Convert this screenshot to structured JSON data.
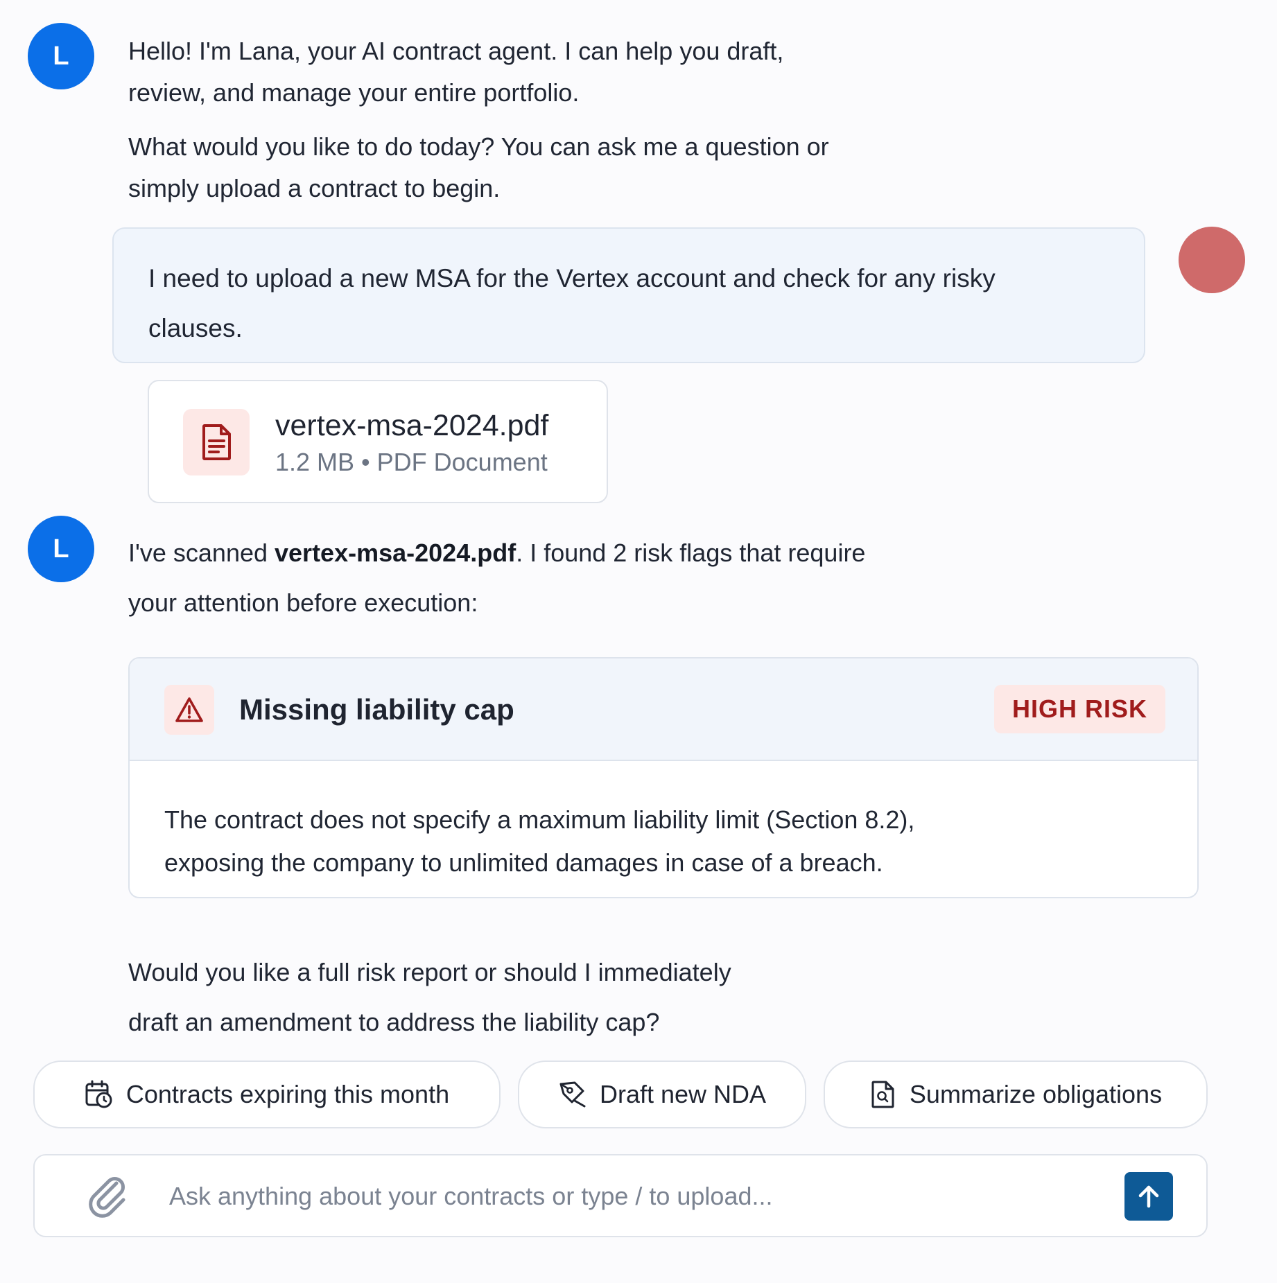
{
  "assistant": {
    "avatar_letter": "L",
    "greeting_line1": "Hello! I'm Lana, your AI contract agent. I can help you draft,",
    "greeting_line2": "review, and manage your entire portfolio.",
    "prompt_line1": "What would you like to do today? You can ask me a question or",
    "prompt_line2": "simply upload a contract to begin.",
    "scan_prefix": "I've scanned ",
    "scan_filename": "vertex-msa-2024.pdf",
    "scan_suffix": ". I found 2 risk flags that require",
    "scan_line2": "your attention before execution:",
    "followup_line1": "Would you like a full risk report or should I immediately",
    "followup_line2": "draft an amendment to address the liability cap?"
  },
  "user": {
    "message_line1": "I need to upload a new MSA for the Vertex account and check for any risky",
    "message_line2": "clauses.",
    "avatar_color": "#cf6a6a"
  },
  "attachment": {
    "name": "vertex-msa-2024.pdf",
    "meta": "1.2 MB • PDF Document",
    "icon": "document-icon"
  },
  "risk_flag": {
    "title": "Missing liability cap",
    "badge": "HIGH RISK",
    "icon": "warning-icon",
    "body_line1": "The contract does not specify a maximum liability limit (Section 8.2),",
    "body_line2": "exposing the company to unlimited damages in case of a breach."
  },
  "suggestions": [
    {
      "label": "Contracts expiring this month",
      "icon": "calendar-clock-icon"
    },
    {
      "label": "Draft new NDA",
      "icon": "pen-icon"
    },
    {
      "label": "Summarize obligations",
      "icon": "file-search-icon"
    }
  ],
  "composer": {
    "placeholder": "Ask anything about your contracts or type / to upload...",
    "attach_icon": "paperclip-icon",
    "send_icon": "arrow-up-icon"
  },
  "colors": {
    "accent": "#0b6fe8",
    "send_button": "#0e5a96",
    "risk_red": "#a01c1c",
    "risk_bg": "#fde8e6"
  }
}
